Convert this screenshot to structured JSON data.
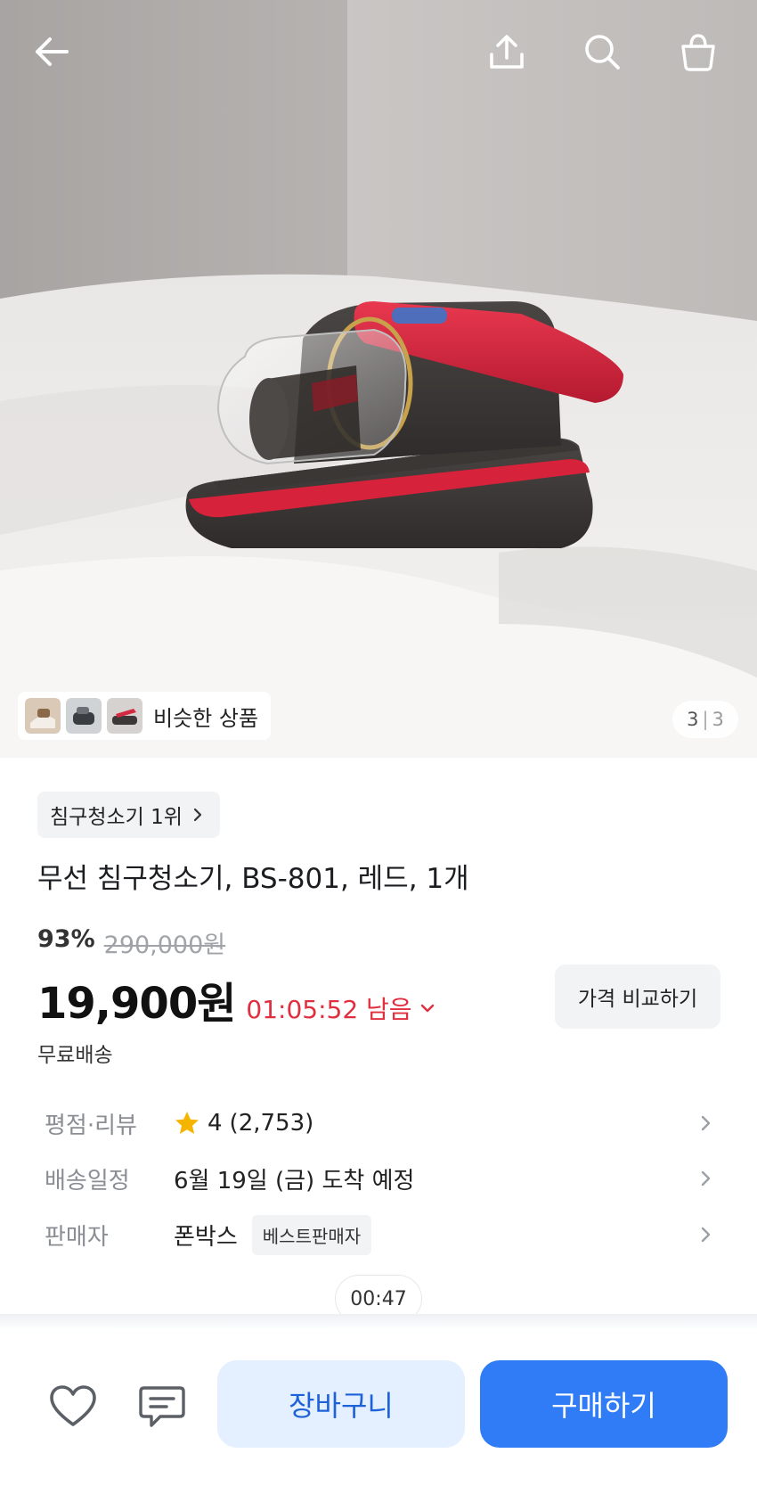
{
  "header": {
    "back_icon": "arrow-left-icon",
    "share_icon": "share-upload-icon",
    "search_icon": "search-icon",
    "cart_icon": "shopping-bag-icon"
  },
  "gallery": {
    "similar_label": "비슷한 상품",
    "current_page": "3",
    "separator": "|",
    "total_pages": "3"
  },
  "product": {
    "rank_chip": "침구청소기 1위",
    "title": "무선 침구청소기, BS-801, 레드, 1개",
    "discount_rate": "93%",
    "original_price": "290,000원",
    "price": "19,900원",
    "countdown": "01:05:52 남음",
    "compare_button": "가격 비교하기",
    "shipping": "무료배송"
  },
  "info_rows": {
    "rating": {
      "label": "평점·리뷰",
      "rating": "4",
      "reviews": "(2,753)"
    },
    "delivery": {
      "label": "배송일정",
      "value": "6월 19일 (금) 도착 예정"
    },
    "seller": {
      "label": "판매자",
      "value": "폰박스",
      "badge": "베스트판매자"
    }
  },
  "video_time": "00:47",
  "bottom_bar": {
    "wishlist_icon": "heart-icon",
    "inquiry_icon": "chat-icon",
    "cart_button": "장바구니",
    "buy_button": "구매하기"
  },
  "colors": {
    "accent_blue": "#2f7cf6",
    "countdown_red": "#e0303f",
    "star_yellow": "#f5b400"
  }
}
